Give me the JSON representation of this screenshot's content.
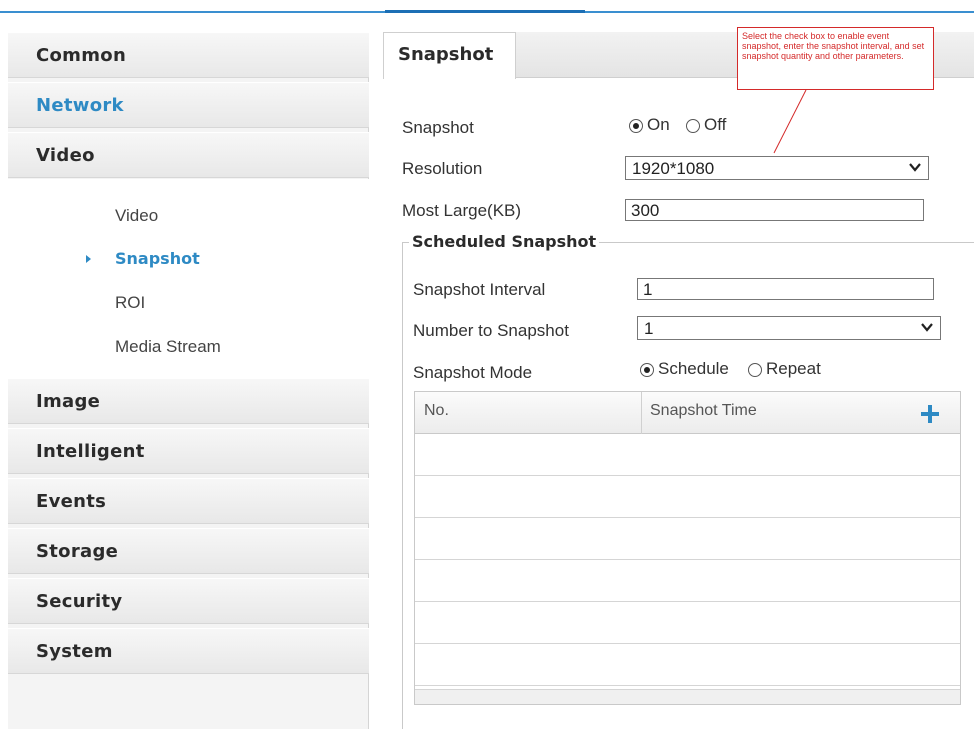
{
  "sidebar": {
    "items": [
      {
        "label": "Common"
      },
      {
        "label": "Network"
      },
      {
        "label": "Video"
      },
      {
        "label": "Image"
      },
      {
        "label": "Intelligent"
      },
      {
        "label": "Events"
      },
      {
        "label": "Storage"
      },
      {
        "label": "Security"
      },
      {
        "label": "System"
      }
    ],
    "active_item": "Network",
    "video_subitems": [
      {
        "label": "Video"
      },
      {
        "label": "Snapshot"
      },
      {
        "label": "ROI"
      },
      {
        "label": "Media Stream"
      }
    ],
    "active_subitem": "Snapshot"
  },
  "tabs": [
    {
      "label": "Snapshot"
    }
  ],
  "callout": {
    "text": "Select the check box to enable event snapshot, enter the snapshot interval, and set snapshot quantity and other parameters."
  },
  "form": {
    "snapshot": {
      "label": "Snapshot",
      "options": [
        "On",
        "Off"
      ],
      "selected": "On"
    },
    "resolution": {
      "label": "Resolution",
      "value": "1920*1080"
    },
    "most_large": {
      "label": "Most Large(KB)",
      "value": "300"
    },
    "scheduled": {
      "legend": "Scheduled Snapshot",
      "interval": {
        "label": "Snapshot Interval",
        "value": "1"
      },
      "number": {
        "label": "Number to Snapshot",
        "value": "1"
      },
      "mode": {
        "label": "Snapshot Mode",
        "options": [
          "Schedule",
          "Repeat"
        ],
        "selected": "Schedule"
      },
      "table": {
        "columns": [
          "No.",
          "Snapshot Time"
        ],
        "rows": []
      }
    }
  },
  "colors": {
    "accent": "#2e8ac4",
    "callout": "#d42a2a",
    "header_bar": "#3a8fd0"
  },
  "icons": {
    "select_arrow": "chevron-down-icon",
    "add": "plus-icon",
    "sub_marker": "triangle-right-icon"
  }
}
